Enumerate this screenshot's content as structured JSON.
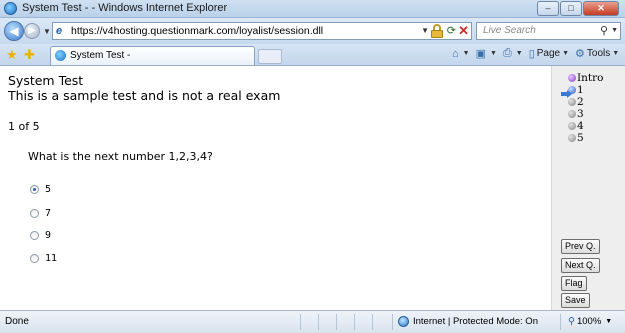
{
  "window": {
    "title": "System Test - - Windows Internet Explorer",
    "minimize": "–",
    "maximize": "□",
    "close": "✕"
  },
  "address_bar": {
    "url": "https://v4hosting.questionmark.com/loyalist/session.dll",
    "search_placeholder": "Live Search"
  },
  "tabs": [
    {
      "label": "System Test -"
    }
  ],
  "command_bar": {
    "home": "",
    "feeds": "",
    "print": "",
    "page": "Page",
    "tools": "Tools"
  },
  "test": {
    "title": "System Test",
    "subtitle": "This is a sample test and is not a real exam",
    "progress": "1 of 5",
    "question": "What is the next number 1,2,3,4?",
    "options": [
      {
        "label": "5",
        "selected": true
      },
      {
        "label": "7",
        "selected": false
      },
      {
        "label": "9",
        "selected": false
      },
      {
        "label": "11",
        "selected": false
      }
    ]
  },
  "side_nav": {
    "items": [
      {
        "label": "Intro",
        "color": "purple",
        "current": false
      },
      {
        "label": "1",
        "color": "blue",
        "current": true
      },
      {
        "label": "2",
        "color": "gray",
        "current": false
      },
      {
        "label": "3",
        "color": "gray",
        "current": false
      },
      {
        "label": "4",
        "color": "gray",
        "current": false
      },
      {
        "label": "5",
        "color": "gray",
        "current": false
      }
    ],
    "buttons": {
      "prev": "Prev Q.",
      "next": "Next Q.",
      "flag": "Flag",
      "save": "Save"
    }
  },
  "status_bar": {
    "status": "Done",
    "zone": "Internet | Protected Mode: On",
    "zoom": "100%"
  },
  "icons": {
    "ie_logo": "ie-icon",
    "back": "back-arrow-icon",
    "forward": "forward-arrow-icon",
    "lock": "lock-icon",
    "refresh": "refresh-icon",
    "stop": "stop-icon",
    "search": "search-icon",
    "favorites": "favorites-star-icon",
    "add_favorite": "add-favorite-icon",
    "globe": "internet-globe-icon",
    "current_marker": "current-question-arrow-icon"
  }
}
